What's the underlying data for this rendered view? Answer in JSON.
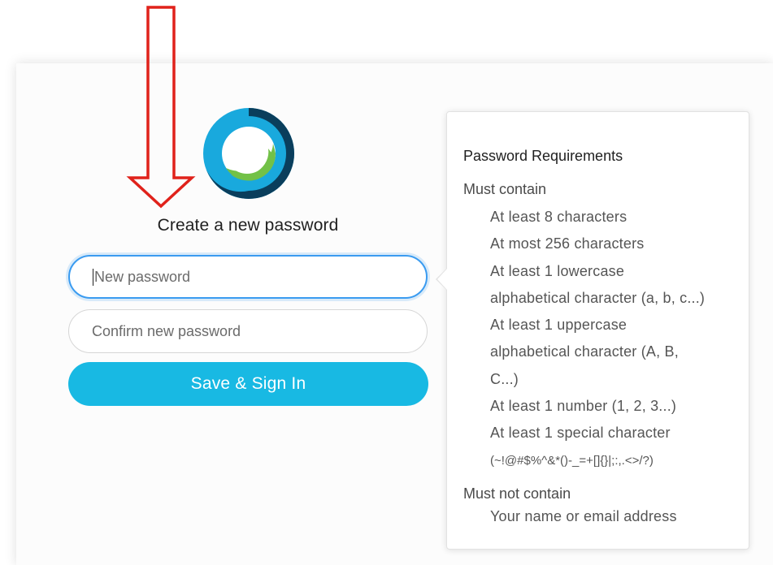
{
  "form": {
    "heading": "Create a new password",
    "new_password_placeholder": "New password",
    "confirm_password_placeholder": "Confirm new password",
    "submit_label": "Save & Sign In"
  },
  "requirements": {
    "title": "Password Requirements",
    "must_contain_label": "Must contain",
    "must_contain": [
      "At least 8 characters",
      "At most 256 characters",
      "At least 1 lowercase",
      "alphabetical character (a, b, c...)",
      "At least 1 uppercase",
      "alphabetical character (A, B,",
      "C...)",
      "At least 1 number (1, 2, 3...)",
      "At least 1 special character",
      "(~!@#$%^&*()-_=+[]{}|;:,.<>/?)"
    ],
    "must_not_contain_label": "Must not contain",
    "must_not_contain": [
      "Your name or email address"
    ]
  },
  "colors": {
    "accent": "#18b9e3",
    "focus_ring": "#3a9bf0",
    "annotation_arrow": "#e0221b",
    "logo_outer": "#19a9dd",
    "logo_dark": "#0a3e5c",
    "logo_green": "#72c147"
  },
  "icons": {
    "logo": "webex-logo-icon",
    "annotation": "down-arrow-annotation-icon"
  }
}
